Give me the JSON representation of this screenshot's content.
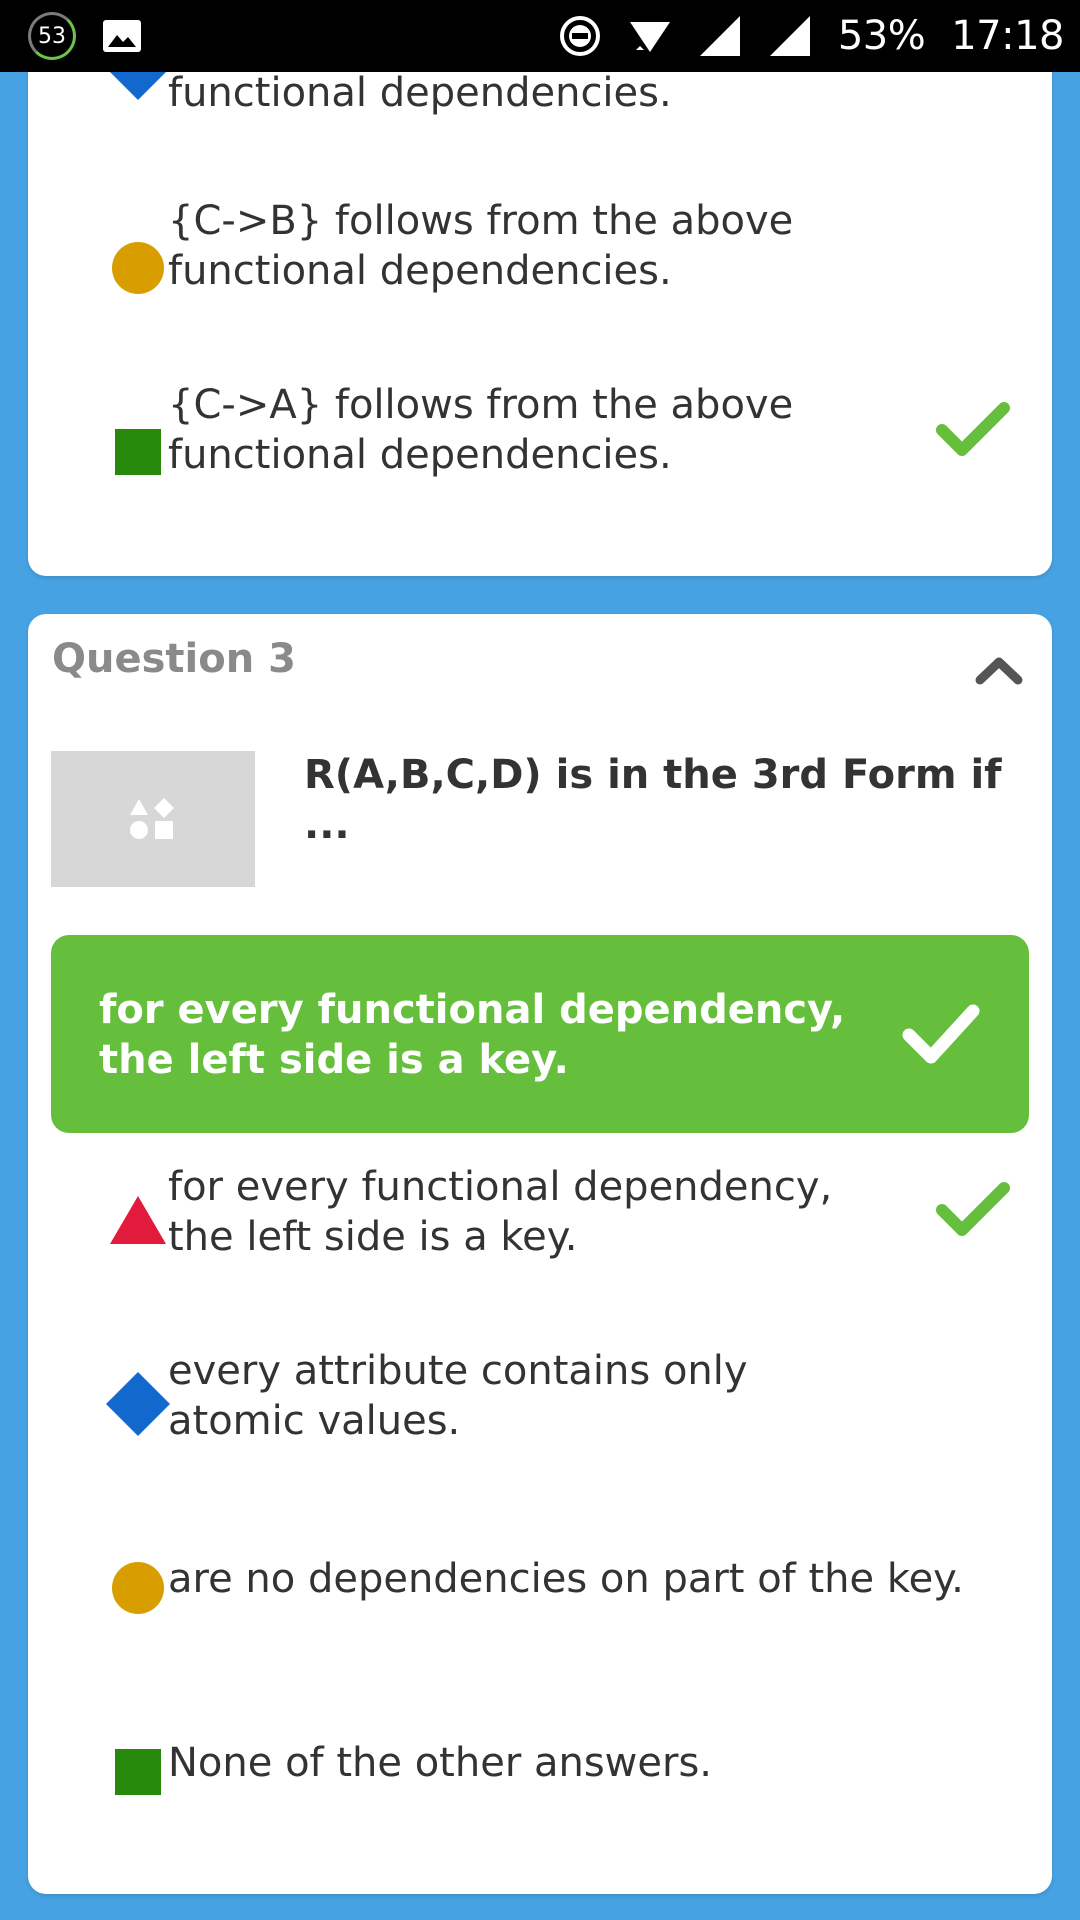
{
  "status_bar": {
    "notification_count": "53",
    "battery": "53%",
    "time": "17:18"
  },
  "colors": {
    "background": "#46a2e3",
    "correct": "#66bf3c",
    "triangle": "#e21b3c",
    "diamond": "#1368ce",
    "circle": "#d89e00",
    "square": "#26890c"
  },
  "previous_question": {
    "options": [
      {
        "shape": "diamond-icon",
        "text": "{D->C} follows from the above functional dependencies.",
        "correct": false
      },
      {
        "shape": "circle-icon",
        "text": "{C->B} follows from the above functional dependencies.",
        "correct": false
      },
      {
        "shape": "square-icon",
        "text": "{C->A} follows from the above functional dependencies.",
        "correct": true
      }
    ]
  },
  "question3": {
    "title": "Question 3",
    "image_icon": "shapes-placeholder-icon",
    "text": "R(A,B,C,D) is in the 3rd Form if ...",
    "correct_answer": "for every functional dependency, the left side is a key.",
    "options": [
      {
        "shape": "triangle-icon",
        "text": "for every functional dependency, the left side is a key.",
        "correct": true
      },
      {
        "shape": "diamond-icon",
        "text": "every attribute contains only atomic values.",
        "correct": false
      },
      {
        "shape": "circle-icon",
        "text": "are no dependencies on part of the key.",
        "correct": false
      },
      {
        "shape": "square-icon",
        "text": "None of the other answers.",
        "correct": false
      }
    ]
  }
}
